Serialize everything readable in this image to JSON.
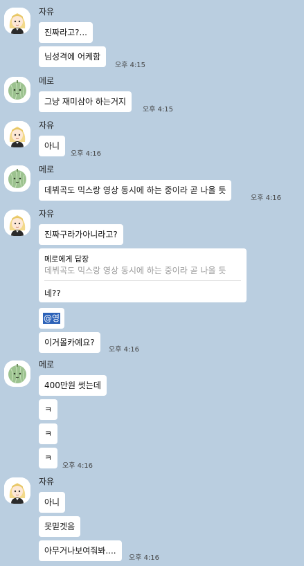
{
  "groups": [
    {
      "sender": "자유",
      "avatar": "blonde-girl",
      "messages": [
        "진짜라고?...",
        "님성격에 어케함"
      ],
      "time": "오후 4:15"
    },
    {
      "sender": "메로",
      "avatar": "green-melon",
      "messages": [
        "그냥 재미삼아 하는거지"
      ],
      "time": "오후 4:15"
    },
    {
      "sender": "자유",
      "avatar": "blonde-girl",
      "messages": [
        "아니"
      ],
      "time": "오후 4:16"
    },
    {
      "sender": "메로",
      "avatar": "green-melon",
      "messages": [
        "데뷔곡도 믹스랑 영상 동시에 하는 중이라 곧 나올 듯"
      ],
      "time": "오후 4:16"
    },
    {
      "sender": "자유",
      "avatar": "blonde-girl",
      "messages": [
        "진짜구라가아니라고?"
      ],
      "reply": {
        "title": "메로에게 답장",
        "quote": "데뷔곡도 믹스랑 영상 동시에 하는 중이라 곧 나올 듯",
        "text": "네??"
      },
      "mention": "@영",
      "last": "이거몰카예요?",
      "time": "오후 4:16"
    },
    {
      "sender": "메로",
      "avatar": "green-melon",
      "messages": [
        "400만원 썻는데",
        "ㅋ",
        "ㅋ",
        "ㅋ"
      ],
      "time": "오후 4:16"
    },
    {
      "sender": "자유",
      "avatar": "blonde-girl",
      "messages": [
        "아니",
        "못믿겟음",
        "아무거나보여줘봐...."
      ],
      "time": "오후 4:16"
    }
  ]
}
